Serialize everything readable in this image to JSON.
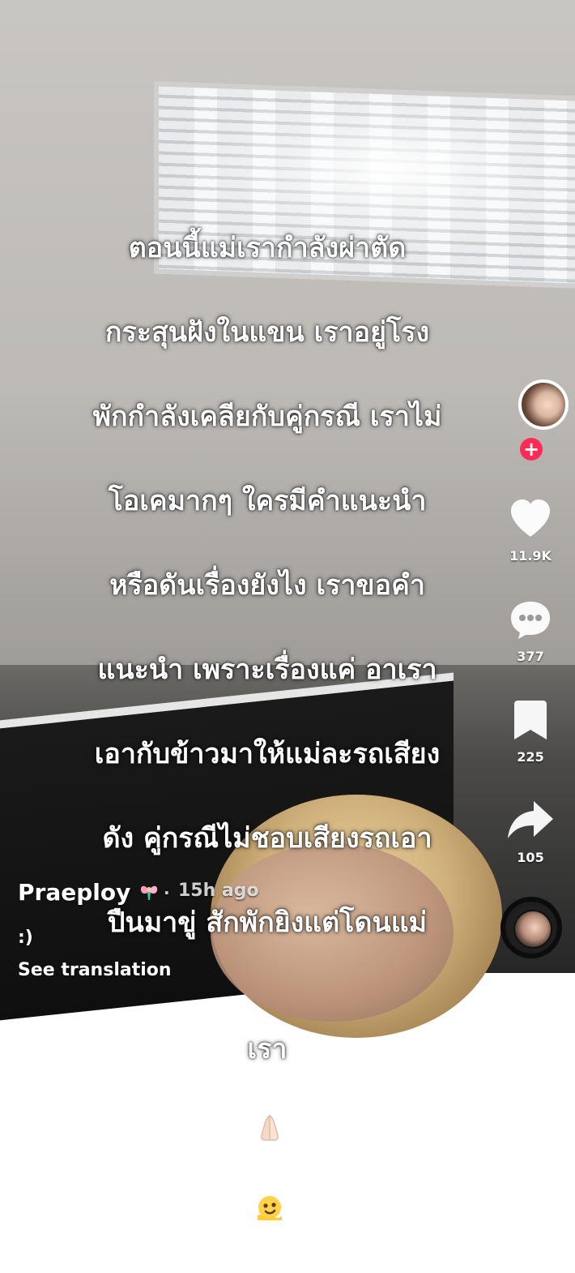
{
  "caption": {
    "lines": [
      "ตอนนี้แม่เรากำลังผ่าตัด",
      "กระสุนฝังในแขน  เราอยู่โรง",
      "พักกำลังเคลียกับคู่กรณี  เราไม่",
      "โอเคมากๆ ใครมีคำแนะนำ",
      "หรือดันเรื่องยังไง  เราขอคำ",
      "แนะนำ  เพราะเรื่องแค่  อาเรา",
      "เอากับข้าวมาให้แม่ละรถเสียง",
      "ดัง  คู่กรณีไม่ชอบเสียงรถเอา",
      "ปืนมาขู่  สักพักยิงแต่โดนแม่",
      "เรา"
    ],
    "emojis": [
      "folded-hands",
      "melting-face"
    ]
  },
  "actions": {
    "likes": "11.9K",
    "comments": "377",
    "saves": "225",
    "shares": "105",
    "follow": "+"
  },
  "post": {
    "username": "Praeploy",
    "username_emoji": "fairy",
    "separator": "·",
    "time": "15h ago",
    "description": ":)",
    "see_translation": "See translation"
  },
  "colors": {
    "accent": "#fe2c55",
    "text": "#ffffff"
  }
}
